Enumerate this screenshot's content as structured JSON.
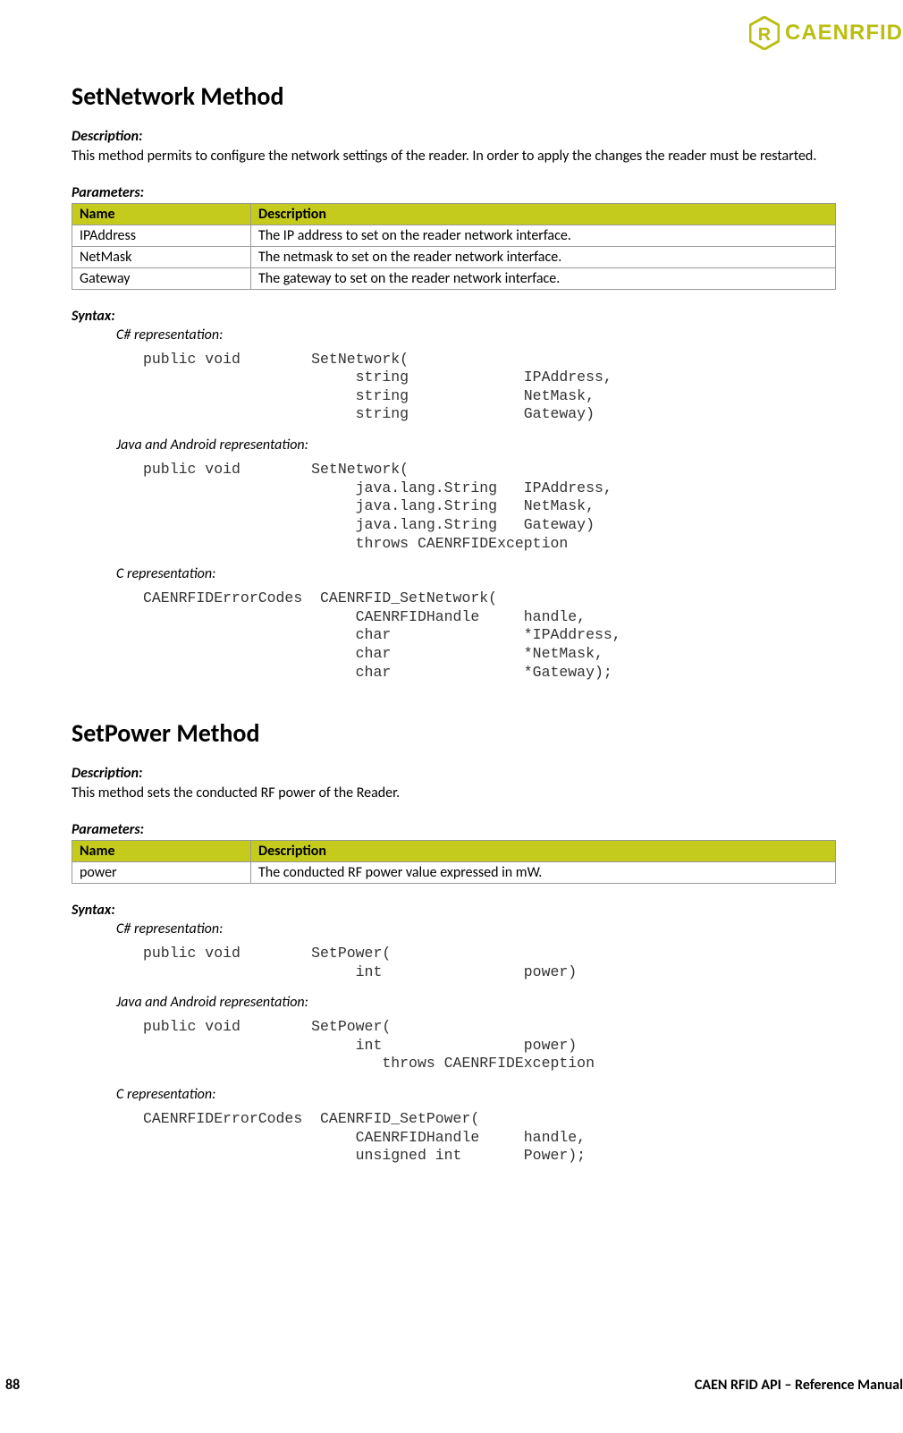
{
  "logo": {
    "text": "CAENRFID"
  },
  "section1": {
    "title": "SetNetwork Method",
    "descLabel": "Description:",
    "descText": "This method permits to configure the network settings of the reader. In order to apply the changes the reader must be restarted.",
    "paramsLabel": "Parameters:",
    "table": {
      "headers": {
        "name": "Name",
        "desc": "Description"
      },
      "rows": [
        {
          "name": "IPAddress",
          "desc": "The IP address to set on the reader network interface."
        },
        {
          "name": "NetMask",
          "desc": "The netmask to set on the reader network interface."
        },
        {
          "name": "Gateway",
          "desc": "The gateway to set on the reader network interface."
        }
      ]
    },
    "syntaxLabel": "Syntax:",
    "reps": {
      "csharp": {
        "label": "C# representation:",
        "code": "public void        SetNetwork(\n                        string             IPAddress,\n                        string             NetMask,\n                        string             Gateway)"
      },
      "java": {
        "label": "Java and Android representation:",
        "code": "public void        SetNetwork(\n                        java.lang.String   IPAddress,\n                        java.lang.String   NetMask,\n                        java.lang.String   Gateway)\n                        throws CAENRFIDException"
      },
      "c": {
        "label": "C representation:",
        "code": "CAENRFIDErrorCodes  CAENRFID_SetNetwork(\n                        CAENRFIDHandle     handle,\n                        char               *IPAddress,\n                        char               *NetMask,\n                        char               *Gateway);"
      }
    }
  },
  "section2": {
    "title": "SetPower Method",
    "descLabel": "Description:",
    "descText": "This method sets the conducted RF power of the Reader.",
    "paramsLabel": "Parameters:",
    "table": {
      "headers": {
        "name": "Name",
        "desc": "Description"
      },
      "rows": [
        {
          "name": "power",
          "desc": "The conducted RF power value expressed in mW."
        }
      ]
    },
    "syntaxLabel": "Syntax:",
    "reps": {
      "csharp": {
        "label": "C# representation:",
        "code": "public void        SetPower(\n                        int                power)"
      },
      "java": {
        "label": "Java and Android representation:",
        "code": "public void        SetPower(\n                        int                power)\n                           throws CAENRFIDException"
      },
      "c": {
        "label": "C representation:",
        "code": "CAENRFIDErrorCodes  CAENRFID_SetPower(\n                        CAENRFIDHandle     handle,\n                        unsigned int       Power);"
      }
    }
  },
  "footer": {
    "page": "88",
    "title": "CAEN RFID API – Reference Manual"
  }
}
